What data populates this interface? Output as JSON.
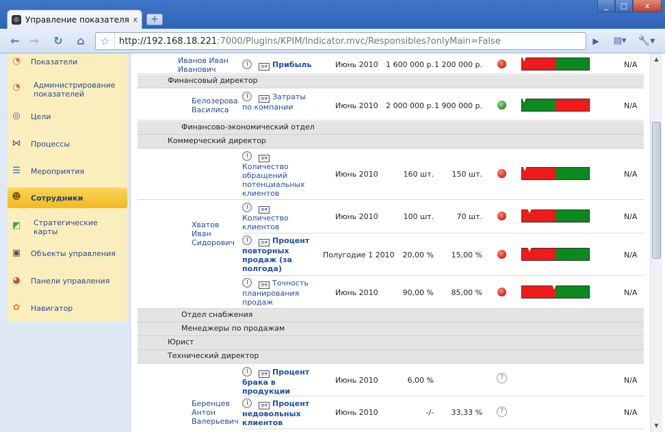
{
  "browser": {
    "tab_title": "Управление показателям...",
    "tab_close": "x",
    "new_tab": "+",
    "win_min": "_",
    "win_max": "□",
    "win_close": "x",
    "url_host": "http://192.168.18.221",
    "url_rest": ":7000/Plugins/KPIM/Indicator.mvc/Responsibles?onlyMain=False"
  },
  "sidebar": {
    "items": [
      {
        "label": "Показатели",
        "icon": "gauge-icon"
      },
      {
        "label": "Администрирование показателей",
        "icon": "gauge-admin-icon"
      },
      {
        "label": "Цели",
        "icon": "target-icon"
      },
      {
        "label": "Процессы",
        "icon": "process-icon"
      },
      {
        "label": "Мероприятия",
        "icon": "events-icon"
      },
      {
        "label": "Сотрудники",
        "icon": "people-icon"
      },
      {
        "label": "Стратегические карты",
        "icon": "map-icon"
      },
      {
        "label": "Объекты управления",
        "icon": "briefcase-icon"
      },
      {
        "label": "Панели управления",
        "icon": "dashboard-icon"
      },
      {
        "label": "Навигатор",
        "icon": "navigator-icon"
      }
    ]
  },
  "groups": {
    "findir": "Финансовый директор",
    "fineco": "Финансово-экономический отдел",
    "comdir": "Коммерческий директор",
    "supply": "Отдел снабжения",
    "salesmgr": "Менеджеры по продажам",
    "lawyer": "Юрист",
    "techdir": "Технический директор"
  },
  "people": {
    "ivanov": "Иванов Иван Иванович",
    "belozerova": "Белозерова Василиса",
    "khvatov": "Хватов Иван Сидорович",
    "berentsev": "Беренцев Антон Валерьевич"
  },
  "rows": [
    {
      "name": "Прибыль",
      "bold": true,
      "period": "Июнь 2010",
      "plan": "1 600 000 р.",
      "fact": "1 200 000 р.",
      "status": "red",
      "na": "N/A"
    },
    {
      "name": "Затраты по компании",
      "bold": false,
      "period": "Июнь 2010",
      "plan": "2 000 000 р.",
      "fact": "1 900 000 р.",
      "status": "green",
      "na": "N/A"
    },
    {
      "name": "Количество обращений потенциальных клиентов",
      "bold": false,
      "period": "Июнь 2010",
      "plan": "160 шт.",
      "fact": "150 шт.",
      "status": "red",
      "na": "N/A"
    },
    {
      "name": "Количество клиентов",
      "bold": false,
      "period": "Июнь 2010",
      "plan": "100 шт.",
      "fact": "70 шт.",
      "status": "red",
      "na": "N/A"
    },
    {
      "name": "Процент повторных продаж (за полгода)",
      "bold": true,
      "period": "Полугодие 1 2010",
      "plan": "20,00 %",
      "fact": "15,00 %",
      "status": "red",
      "na": "N/A"
    },
    {
      "name": "Точность планирования продаж",
      "bold": false,
      "period": "Июнь 2010",
      "plan": "90,00 %",
      "fact": "85,00 %",
      "status": "red",
      "na": "N/A"
    },
    {
      "name": "Процент брака в продукции",
      "bold": true,
      "period": "Июнь 2010",
      "plan": "6,00 %",
      "fact": "",
      "status": "unknown",
      "na": "N/A"
    },
    {
      "name": "Процент недовольных клиентов",
      "bold": true,
      "period": "Июнь 2010",
      "plan": "-/-",
      "fact": "33,33 %",
      "status": "unknown",
      "na": "N/A"
    }
  ],
  "colors": {
    "red": "#ef1b1b",
    "green": "#0b8a1e",
    "sidebar_bg": "#fbeebd",
    "active": "#f2b91f"
  }
}
